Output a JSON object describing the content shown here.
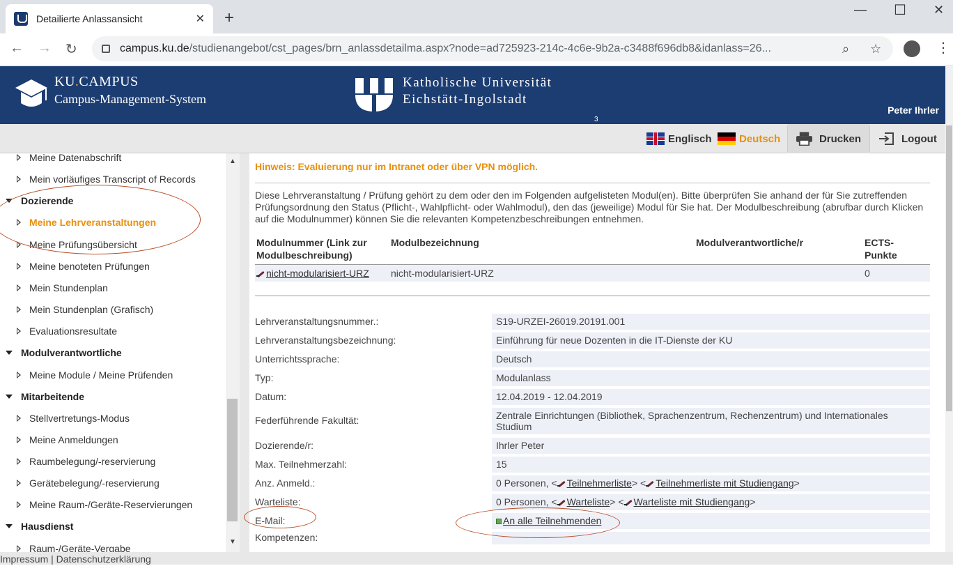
{
  "browser": {
    "tab_title": "Detailierte Anlassansicht",
    "url_host": "campus.ku.de",
    "url_path": "/studienangebot/cst_pages/brn_anlassdetailma.aspx?node=ad725923-214c-4c6e-9b2a-c3488f696db8&idanlass=26..."
  },
  "header": {
    "logo_brand": "KU",
    "logo_dot": ".",
    "logo_campus": "CAMPUS",
    "logo_subtitle": "Campus-Management-System",
    "university_line1": "Katholische Universität",
    "university_line2": "Eichstätt-Ingolstadt",
    "user": "Peter Ihrler",
    "small_number": "3"
  },
  "toolbar": {
    "lang_en": "Englisch",
    "lang_de": "Deutsch",
    "print": "Drucken",
    "logout": "Logout"
  },
  "sidebar": {
    "items": [
      {
        "label": "Meine Datenabschrift",
        "type": "item"
      },
      {
        "label": "Mein vorläufiges Transcript of Records",
        "type": "item"
      },
      {
        "label": "Dozierende",
        "type": "head"
      },
      {
        "label": "Meine Lehrveranstaltungen",
        "type": "item",
        "active": true
      },
      {
        "label": "Meine Prüfungsübersicht",
        "type": "item"
      },
      {
        "label": "Meine benoteten Prüfungen",
        "type": "item"
      },
      {
        "label": "Mein Stundenplan",
        "type": "item"
      },
      {
        "label": "Mein Stundenplan (Grafisch)",
        "type": "item"
      },
      {
        "label": "Evaluationsresultate",
        "type": "item"
      },
      {
        "label": "Modulverantwortliche",
        "type": "head"
      },
      {
        "label": "Meine Module / Meine Prüfenden",
        "type": "item"
      },
      {
        "label": "Mitarbeitende",
        "type": "head"
      },
      {
        "label": "Stellvertretungs-Modus",
        "type": "item"
      },
      {
        "label": "Meine Anmeldungen",
        "type": "item"
      },
      {
        "label": "Raumbelegung/-reservierung",
        "type": "item"
      },
      {
        "label": "Gerätebelegung/-reservierung",
        "type": "item"
      },
      {
        "label": "Meine Raum-/Geräte-Reservierungen",
        "type": "item"
      },
      {
        "label": "Hausdienst",
        "type": "head"
      },
      {
        "label": "Raum-/Geräte-Vergabe",
        "type": "item"
      }
    ]
  },
  "content": {
    "hint": "Hinweis: Evaluierung nur im Intranet oder über VPN möglich.",
    "intro": "Diese Lehrveranstaltung / Prüfung gehört zu dem oder den im Folgenden aufgelisteten Modul(en). Bitte überprüfen Sie anhand der für Sie zutreffenden Prüfungsordnung den Status (Pflicht-, Wahlpflicht- oder Wahlmodul), den das (jeweilige) Modul für Sie hat. Der Modulbeschreibung (abrufbar durch Klicken auf die Modulnummer) können Sie die relevanten Kompetenzbeschreibungen entnehmen.",
    "module_table": {
      "headers": [
        "Modulnummer (Link zur Modulbeschreibung)",
        "Modulbezeichnung",
        "Modulverantwortliche/r",
        "ECTS-Punkte"
      ],
      "rows": [
        {
          "nummer": "nicht-modularisiert-URZ",
          "bezeichnung": "nicht-modularisiert-URZ",
          "verantwortlich": "",
          "ects": "0"
        }
      ]
    },
    "details": {
      "nummer_label": "Lehrveranstaltungsnummer.:",
      "nummer": "S19-URZEI-26019.20191.001",
      "bezeichnung_label": "Lehrveranstaltungsbezeichnung:",
      "bezeichnung": "Einführung für neue Dozenten in die IT-Dienste der KU",
      "sprache_label": "Unterrichtssprache:",
      "sprache": "Deutsch",
      "typ_label": "Typ:",
      "typ": "Modulanlass",
      "datum_label": "Datum:",
      "datum": "12.04.2019 - 12.04.2019",
      "fakultaet_label": "Federführende Fakultät:",
      "fakultaet": "Zentrale Einrichtungen (Bibliothek, Sprachenzentrum, Rechenzentrum) und Internationales Studium",
      "dozent_label": "Dozierende/r:",
      "dozent": "Ihrler Peter",
      "max_label": "Max. Teilnehmerzahl:",
      "max": "15",
      "anmeld_label": "Anz. Anmeld.:",
      "anmeld_prefix": "0 Personen, <",
      "anmeld_link1": "Teilnehmerliste",
      "anmeld_mid": "> <",
      "anmeld_link2": "Teilnehmerliste mit Studiengang",
      "anmeld_suffix": ">",
      "warte_label": "Warteliste:",
      "warte_prefix": "0 Personen, <",
      "warte_link1": "Warteliste",
      "warte_mid": "> <",
      "warte_link2": "Warteliste mit Studiengang",
      "warte_suffix": ">",
      "email_label": "E-Mail:",
      "email_link": "An alle Teilnehmenden",
      "kompetenzen_label": "Kompetenzen:"
    }
  },
  "footer": {
    "impressum": "Impressum",
    "sep": " | ",
    "datenschutz": "Datenschutzerklärung"
  },
  "colors": {
    "header_bg": "#1c3d72",
    "accent": "#e8900f",
    "annotation": "#b8502a"
  }
}
